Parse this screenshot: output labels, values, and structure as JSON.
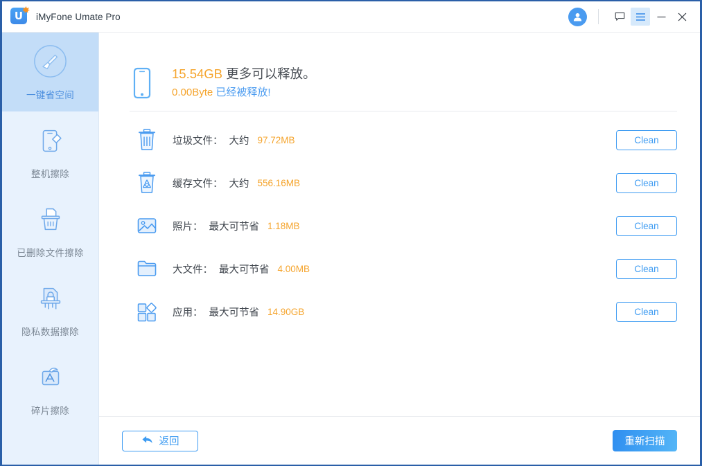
{
  "window": {
    "title": "iMyFone Umate Pro",
    "logo_letter": "U",
    "icons": {
      "logo": "app-logo-icon",
      "account": "account-avatar-icon",
      "feedback": "feedback-icon",
      "menu": "hamburger-menu-icon",
      "minimize": "minimize-icon",
      "close": "close-icon"
    }
  },
  "sidebar": {
    "items": [
      {
        "label": "一键省空间",
        "icon": "broom-circle-icon",
        "active": true
      },
      {
        "label": "整机擦除",
        "icon": "phone-erase-icon",
        "active": false
      },
      {
        "label": "已删除文件擦除",
        "icon": "shredder-trash-icon",
        "active": false
      },
      {
        "label": "隐私数据擦除",
        "icon": "privacy-lock-shredder-icon",
        "active": false
      },
      {
        "label": "碎片擦除",
        "icon": "app-fragment-icon",
        "active": false
      }
    ]
  },
  "summary": {
    "phone_icon": "smartphone-icon",
    "free_amount": "15.54GB",
    "free_text": "更多可以释放。",
    "released_amount": "0.00Byte",
    "released_text": "已经被释放!"
  },
  "rows": [
    {
      "icon": "trash-bin-icon",
      "label": "垃圾文件：",
      "qualifier": "大约",
      "size": "97.72MB",
      "button": "Clean"
    },
    {
      "icon": "cache-recycle-icon",
      "label": "缓存文件：",
      "qualifier": "大约",
      "size": "556.16MB",
      "button": "Clean"
    },
    {
      "icon": "photo-icon",
      "label": "照片：",
      "qualifier": "最大可节省",
      "size": "1.18MB",
      "button": "Clean"
    },
    {
      "icon": "folder-icon",
      "label": "大文件：",
      "qualifier": "最大可节省",
      "size": "4.00MB",
      "button": "Clean"
    },
    {
      "icon": "apps-grid-icon",
      "label": "应用：",
      "qualifier": "最大可节省",
      "size": "14.90GB",
      "button": "Clean"
    }
  ],
  "footer": {
    "back_label": "返回",
    "back_icon": "back-arrow-icon",
    "rescan_label": "重新扫描"
  },
  "colors": {
    "accent_blue": "#3d9bf2",
    "orange": "#f5a42c",
    "sidebar_bg": "#e8f2fd",
    "sidebar_active": "#c3ddf8",
    "window_border": "#2a5fa8"
  }
}
